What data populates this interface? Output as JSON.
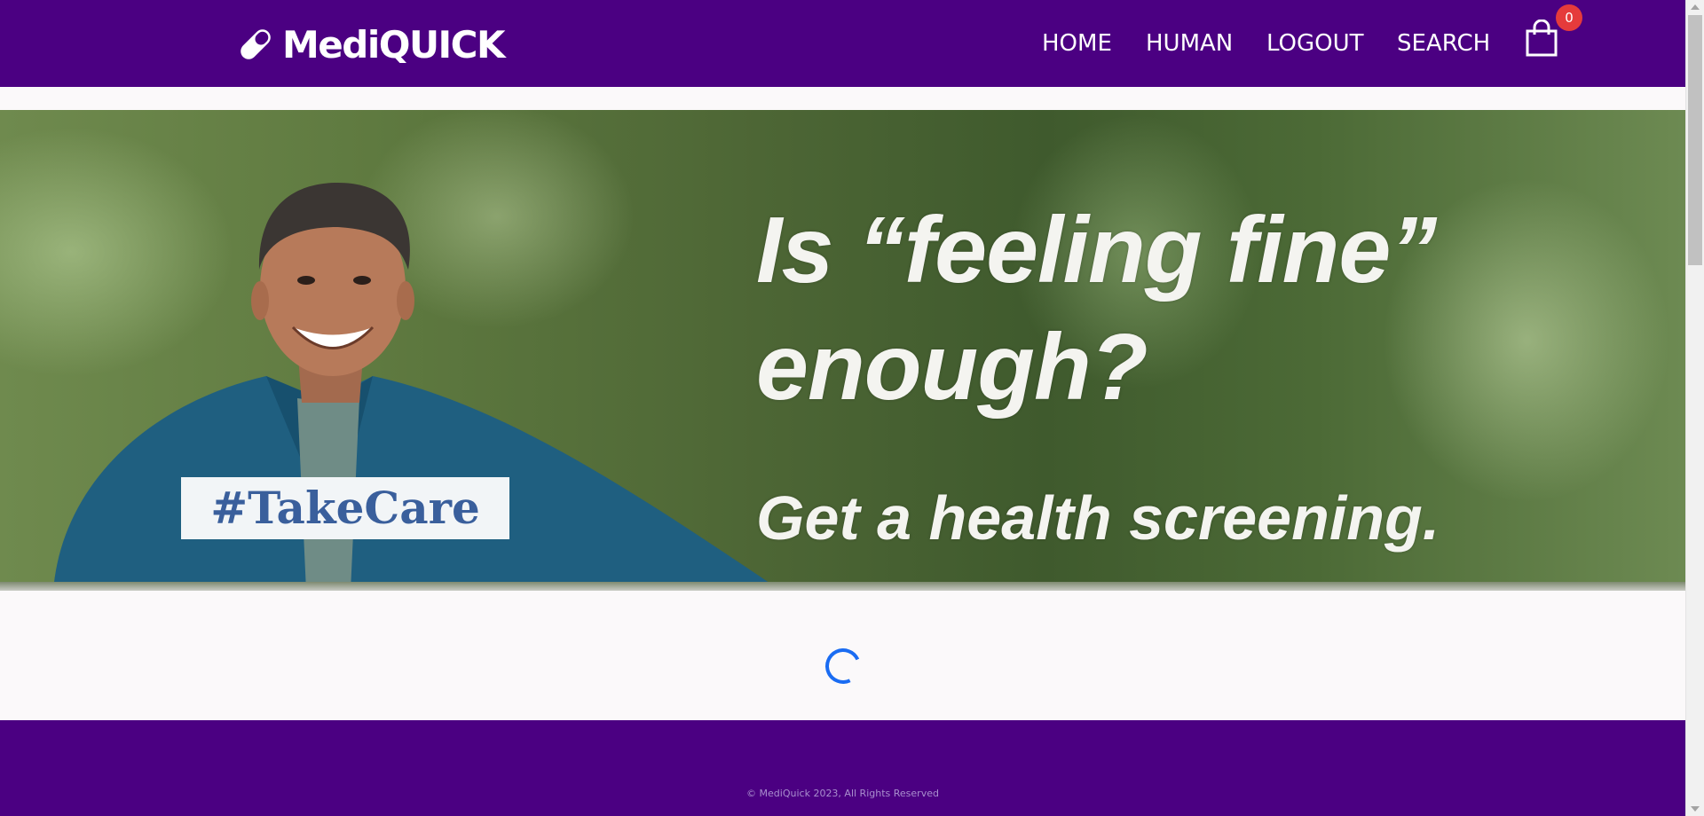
{
  "navbar": {
    "brand": "MediQUICK",
    "brand_icon": "pill-icon",
    "links": [
      "HOME",
      "HUMAN",
      "LOGOUT",
      "SEARCH"
    ],
    "cart_icon": "shopping-bag-icon",
    "cart_count": "0",
    "background": "#4b0082"
  },
  "hero": {
    "headline_line1": "Is “feeling fine”",
    "headline_line2": "enough?",
    "subline": "Get a health screening.",
    "tag": "#TakeCare"
  },
  "content": {
    "loading": true,
    "spinner_color": "#1a6cf2"
  },
  "footer": {
    "copyright": "© MediQuick 2023, All Rights Reserved",
    "background": "#4b0082"
  }
}
